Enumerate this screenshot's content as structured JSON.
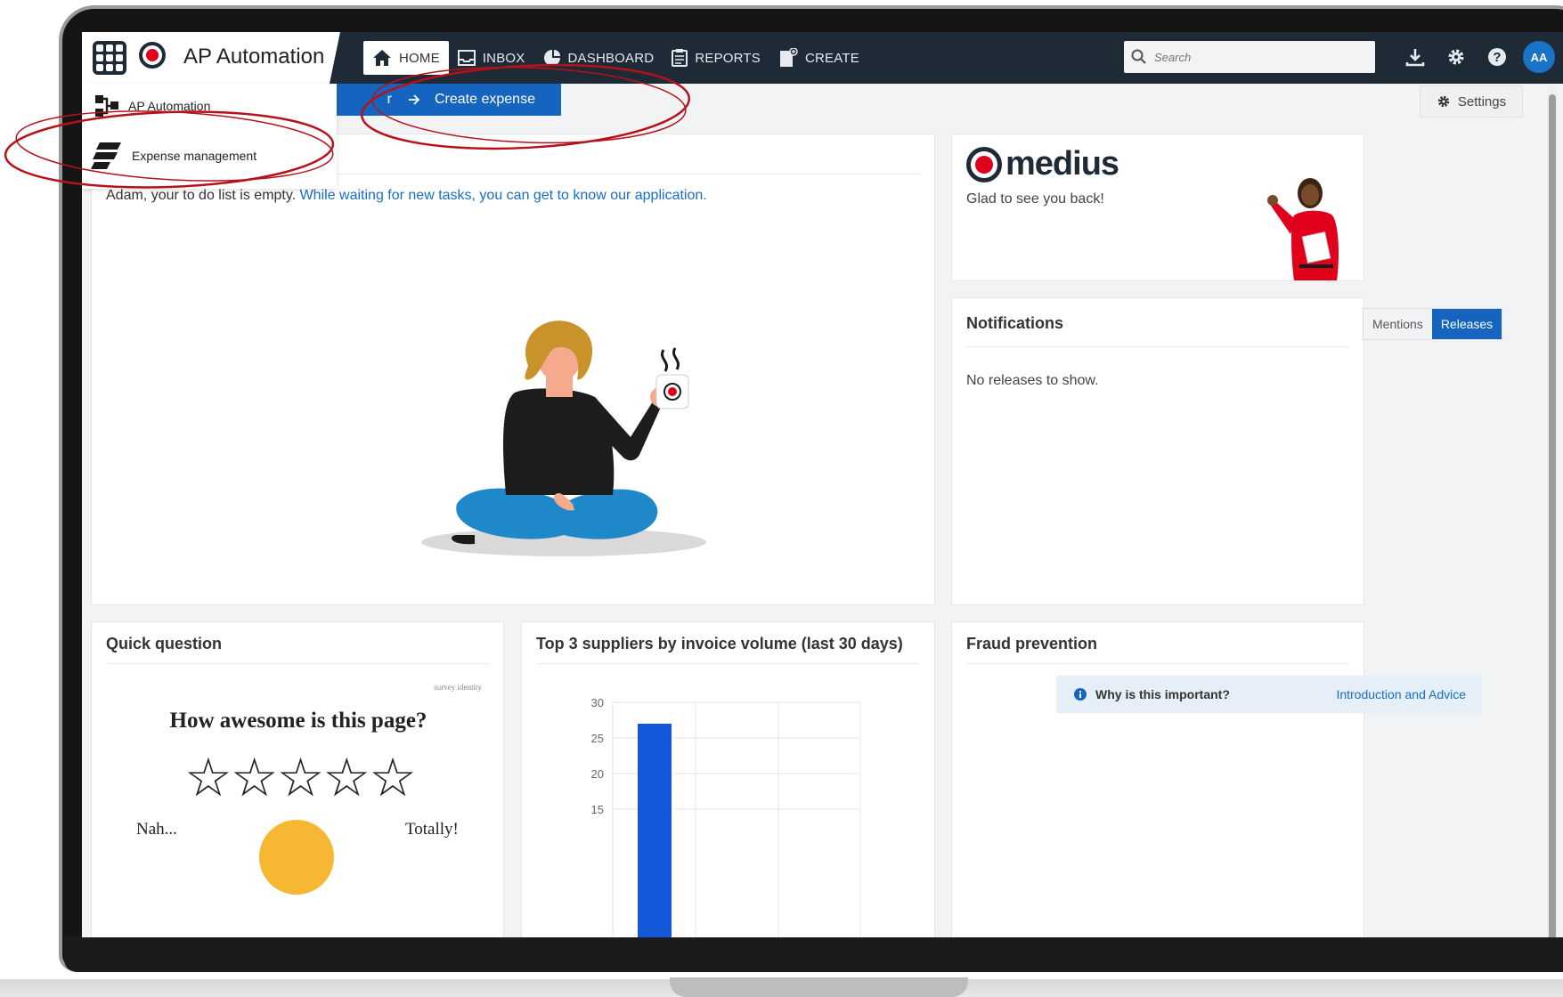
{
  "app": {
    "brand_name": "AP Automation"
  },
  "nav": {
    "items": [
      {
        "label": "HOME",
        "icon": "home-icon",
        "active": true
      },
      {
        "label": "INBOX",
        "icon": "inbox-icon",
        "active": false
      },
      {
        "label": "DASHBOARD",
        "icon": "dashboard-icon",
        "active": false
      },
      {
        "label": "REPORTS",
        "icon": "reports-icon",
        "active": false
      },
      {
        "label": "CREATE",
        "icon": "create-icon",
        "active": false
      }
    ],
    "search_placeholder": "Search",
    "avatar_initials": "AA"
  },
  "app_switcher": {
    "items": [
      {
        "label": "AP Automation",
        "icon": "ap-automation-icon"
      },
      {
        "label": "Expense management",
        "icon": "expense-management-icon"
      }
    ]
  },
  "actions": {
    "request_label": "request",
    "create_expense_label": "Create expense",
    "settings_label": "Settings"
  },
  "todo": {
    "empty_text": "Adam, your to do list is empty.",
    "link_text": "While waiting for new tasks, you can get to know our application."
  },
  "welcome": {
    "brand_word": "medius",
    "greeting": "Glad to see you back!"
  },
  "notifications": {
    "title": "Notifications",
    "tab_mentions": "Mentions",
    "tab_releases": "Releases",
    "active_tab": "Releases",
    "empty_text": "No releases to show."
  },
  "quick_question": {
    "title": "Quick question",
    "watermark": "survey identity",
    "question": "How awesome is this page?",
    "stars": "☆☆☆☆☆",
    "low_label": "Nah...",
    "high_label": "Totally!"
  },
  "suppliers": {
    "title": "Top 3 suppliers by invoice volume (last 30 days)"
  },
  "chart_data": {
    "type": "bar",
    "categories": [
      ""
    ],
    "values": [
      27
    ],
    "y_ticks": [
      "30",
      "25",
      "20",
      "15"
    ],
    "ylim": [
      13,
      30
    ],
    "grid": true,
    "bar_color": "#1358d8"
  },
  "fraud": {
    "title": "Fraud prevention",
    "info_text": "Why is this important?",
    "link_text": "Introduction and Advice"
  },
  "colors": {
    "nav_bg": "#1e2a36",
    "primary": "#1565c0",
    "brand_red": "#e0001b",
    "annotation": "#b5121b"
  }
}
